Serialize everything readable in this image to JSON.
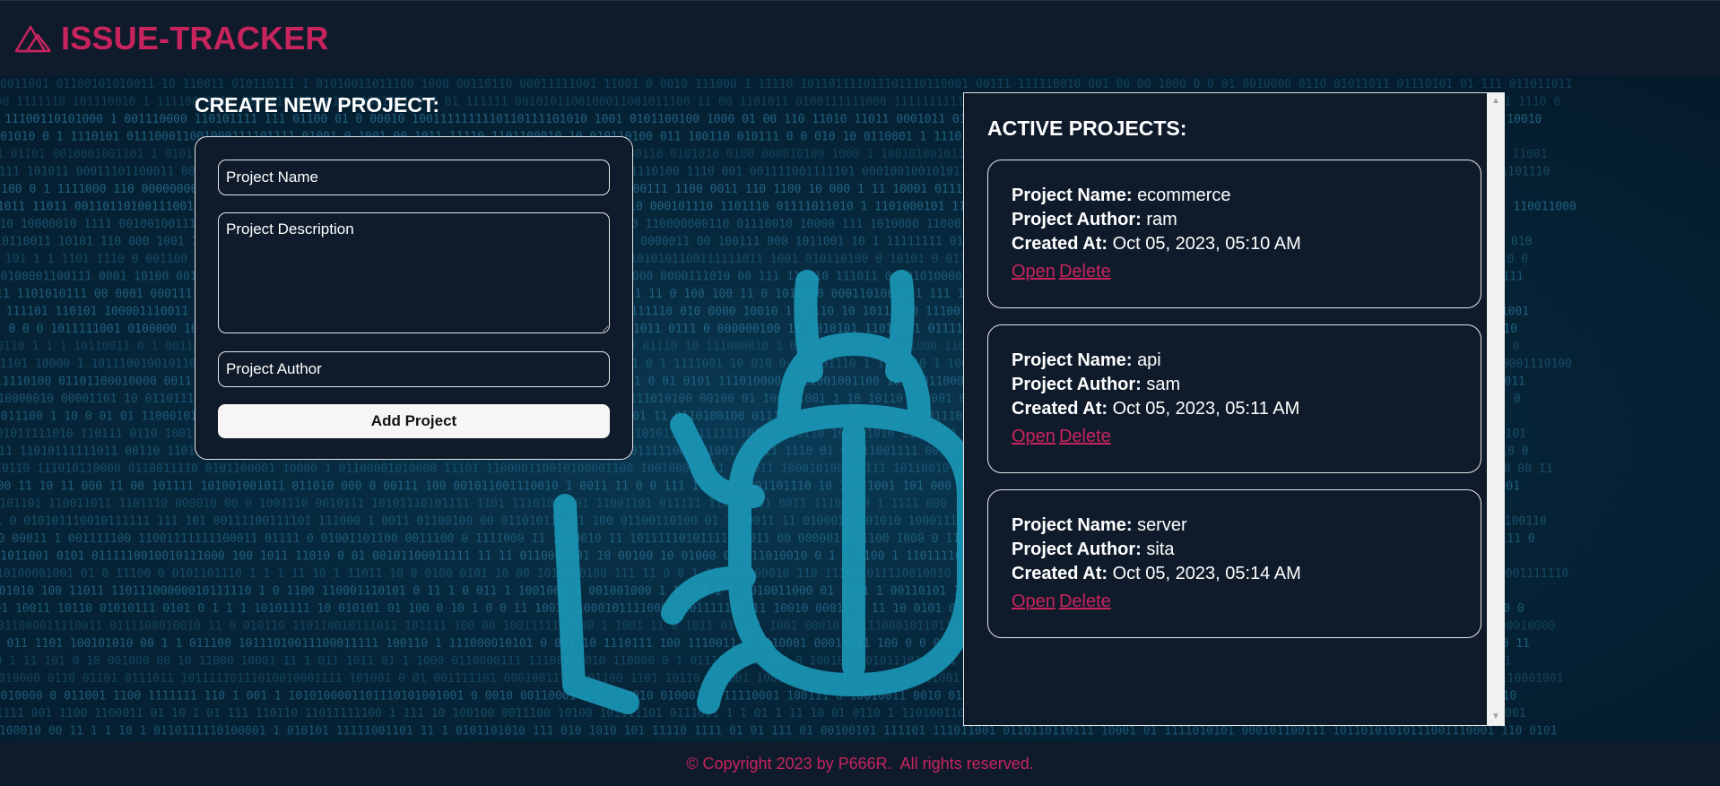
{
  "brand": {
    "title": "ISSUE-TRACKER",
    "icon": "mountain-triangle-icon",
    "color": "#c7245d"
  },
  "create_form": {
    "title": "CREATE NEW PROJECT:",
    "name_placeholder": "Project Name",
    "name_value": "",
    "description_placeholder": "Project Description",
    "description_value": "",
    "author_placeholder": "Project Author",
    "author_value": "",
    "submit_label": "Add Project"
  },
  "projects": {
    "title": "ACTIVE PROJECTS:",
    "labels": {
      "name": "Project Name:",
      "author": "Project Author:",
      "created": "Created At:"
    },
    "open_label": "Open",
    "delete_label": "Delete",
    "items": [
      {
        "name": "ecommerce",
        "author": "ram",
        "created_at": "Oct 05, 2023, 05:10 AM"
      },
      {
        "name": "api",
        "author": "sam",
        "created_at": "Oct 05, 2023, 05:11 AM"
      },
      {
        "name": "server",
        "author": "sita",
        "created_at": "Oct 05, 2023, 05:14 AM"
      }
    ]
  },
  "background": {
    "icon": "bug-icon"
  },
  "footer": {
    "text": "© Copyright 2023 by P666R.  All rights reserved."
  },
  "colors": {
    "accent": "#c7245d",
    "panel": "#0f1b2b",
    "bug": "#1b98b8"
  }
}
